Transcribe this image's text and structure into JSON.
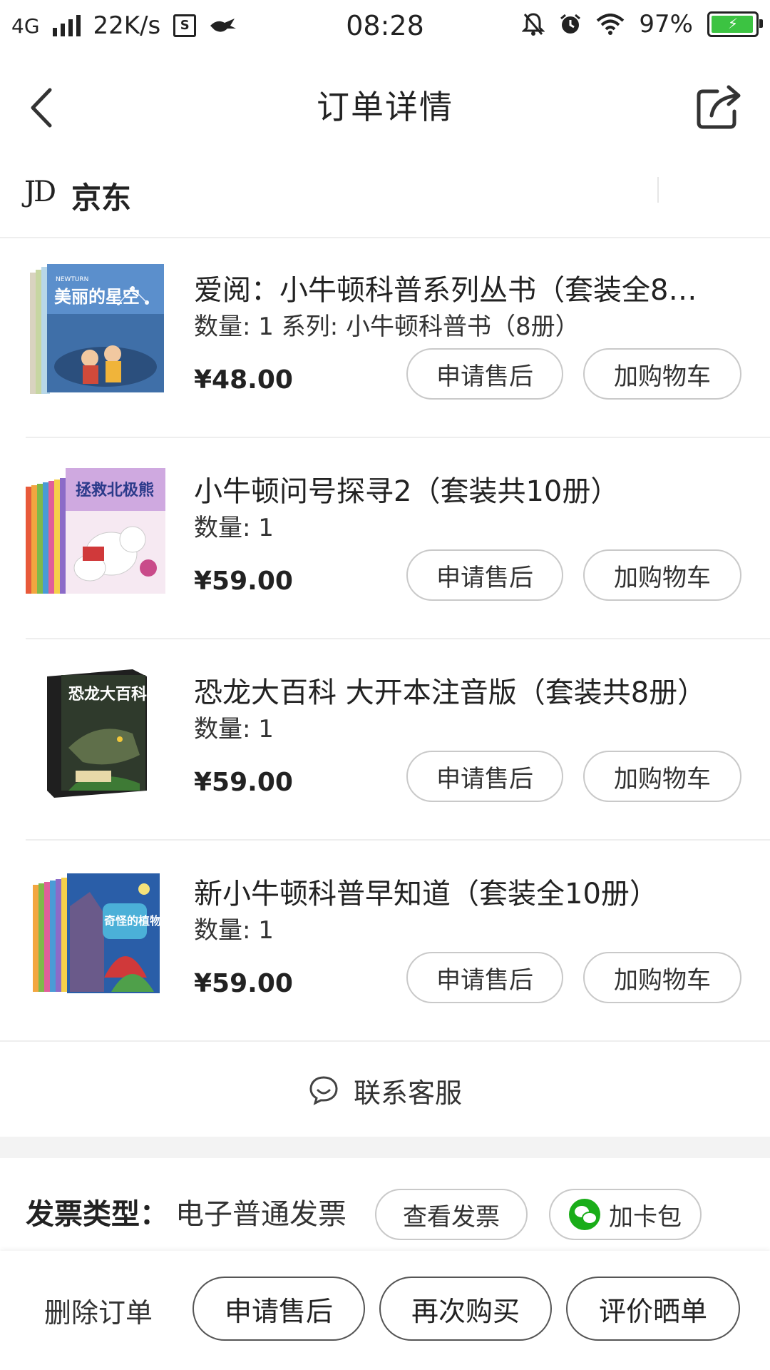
{
  "status_bar": {
    "network": "4G",
    "speed": "22K/s",
    "s_badge": "S",
    "time": "08:28",
    "battery_percent": "97%",
    "battery_level": 0.97
  },
  "header": {
    "title": "订单详情"
  },
  "shop": {
    "logo": "JD",
    "name": "京东"
  },
  "products": [
    {
      "name": "爱阅：小牛顿科普系列丛书（套装全8…",
      "qty": "数量: 1 系列: 小牛顿科普书（8册）",
      "price": "¥48.00",
      "cover_text": "美丽的星空",
      "aftersale_label": "申请售后",
      "cart_label": "加购物车"
    },
    {
      "name": "小牛顿问号探寻2（套装共10册）",
      "qty": "数量: 1",
      "price": "¥59.00",
      "cover_text": "拯救北极熊",
      "aftersale_label": "申请售后",
      "cart_label": "加购物车"
    },
    {
      "name": "恐龙大百科 大开本注音版（套装共8册）",
      "qty": "数量: 1",
      "price": "¥59.00",
      "cover_text": "恐龙大百科",
      "aftersale_label": "申请售后",
      "cart_label": "加购物车"
    },
    {
      "name": "新小牛顿科普早知道（套装全10册）",
      "qty": "数量: 1",
      "price": "¥59.00",
      "cover_text": "奇怪的植物",
      "aftersale_label": "申请售后",
      "cart_label": "加购物车"
    }
  ],
  "contact": {
    "label": "联系客服"
  },
  "invoice": {
    "label": "发票类型：",
    "value": "电子普通发票",
    "view_label": "查看发票",
    "card_label": "加卡包"
  },
  "bottom_bar": {
    "delete_label": "删除订单",
    "aftersale_label": "申请售后",
    "rebuy_label": "再次购买",
    "review_label": "评价晒单"
  },
  "colors": {
    "wechat_green": "#1aad19",
    "battery_green": "#3cc342",
    "separator": "#eeeeee"
  }
}
